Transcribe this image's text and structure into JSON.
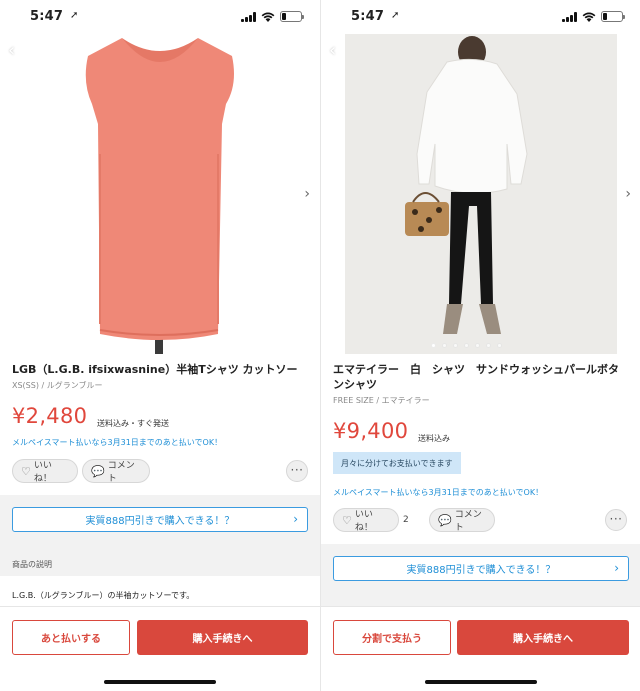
{
  "status": {
    "time": "5:47"
  },
  "left": {
    "title": "LGB（L.G.B. ifsixwasnine）半袖Tシャツ カットソー",
    "sub": "XS(SS) / ルグランブルー",
    "price": "¥2,480",
    "price_note": "送料込み・すぐ発送",
    "mpay": "メルペイスマート払いなら3月31日までのあと払いでOK！",
    "like_label": "いいね！",
    "comment_label": "コメント",
    "cta": "実質888円引きで購入できる！？",
    "section_label": "商品の説明",
    "desc": "L.G.B.（ルグランブルー）の半袖カットソーです。",
    "btn_secondary": "あと払いする",
    "btn_primary": "購入手続きへ"
  },
  "right": {
    "title": "エマテイラー　白　シャツ　サンドウォッシュパールボタンシャツ",
    "sub": "FREE SIZE / エマテイラー",
    "price": "¥9,400",
    "price_note": "送料込み",
    "installment": "月々に分けてお支払いできます",
    "mpay": "メルペイスマート払いなら3月31日までのあと払いでOK！",
    "like_label": "いいね！",
    "like_count": "2",
    "comment_label": "コメント",
    "cta": "実質888円引きで購入できる！？",
    "btn_secondary": "分割で支払う",
    "btn_primary": "購入手続きへ"
  },
  "colors": {
    "accent_red": "#d9483d",
    "price_red": "#e0473c",
    "link_blue": "#1f8fd6"
  },
  "icons": [
    "back-chevron-icon",
    "next-chevron-icon",
    "heart-icon",
    "comment-icon",
    "more-icon",
    "signal-icon",
    "wifi-icon",
    "battery-icon",
    "location-arrow-icon"
  ]
}
